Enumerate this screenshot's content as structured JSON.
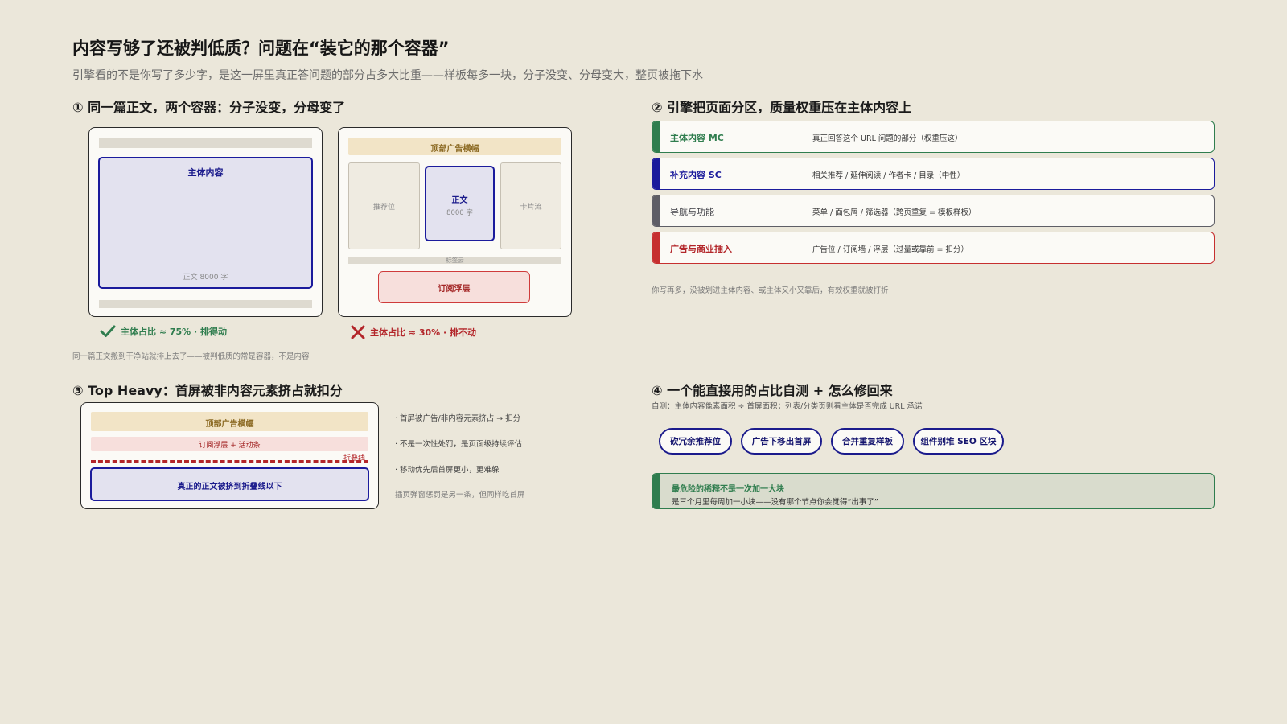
{
  "header": {
    "title": "内容写够了还被判低质？问题在“装它的那个容器”",
    "subtitle": "引擎看的不是你写了多少字，是这一屏里真正答问题的部分占多大比重——样板每多一块，分子没变、分母变大，整页被拖下水"
  },
  "section1": {
    "heading": "① 同一篇正文，两个容器：分子没变，分母变了",
    "clean": {
      "main_label": "主体内容",
      "word_count": "正文 8000 字",
      "verdict_icon": "check-icon",
      "verdict": "主体占比 ≈ 75% · 排得动",
      "verdict_color": "#2f7d4e"
    },
    "cluttered": {
      "ad_banner": "顶部广告横幅",
      "left_col": "推荐位",
      "center_label": "正文",
      "center_count": "8000 字",
      "right_col": "卡片流",
      "tag_cloud": "标签云",
      "sub_layer": "订阅浮层",
      "verdict_icon": "cross-icon",
      "verdict": "主体占比 ≈ 30% · 排不动",
      "verdict_color": "#b3262a"
    },
    "note": "同一篇正文搬到干净站就排上去了——被判低质的常是容器，不是内容"
  },
  "section2": {
    "heading": "② 引擎把页面分区，质量权重压在主体内容上",
    "zones": [
      {
        "name": "主体内容 MC",
        "desc": "真正回答这个 URL 问题的部分（权重压这）",
        "color": "#2f7d4e"
      },
      {
        "name": "补充内容 SC",
        "desc": "相关推荐 / 延伸阅读 / 作者卡 / 目录（中性）",
        "color": "#1b1b9c"
      },
      {
        "name": "导航与功能",
        "desc": "菜单 / 面包屑 / 筛选器（跨页重复 = 模板样板）",
        "color": "#5e5e66"
      },
      {
        "name": "广告与商业插入",
        "desc": "广告位 / 订阅墙 / 浮层（过量或靠前 = 扣分）",
        "color": "#c62f2f"
      }
    ],
    "note": "你写再多，没被划进主体内容、或主体又小又靠后，有效权重就被打折"
  },
  "section3": {
    "heading": "③ Top Heavy：首屏被非内容元素挤占就扣分",
    "ad_banner": "顶部广告横幅",
    "sub_bar": "订阅浮层 + 活动条",
    "fold_label": "折叠线",
    "content_label": "真正的正文被挤到折叠线以下",
    "bullets": [
      "· 首屏被广告/非内容元素挤占 → 扣分",
      "· 不是一次性处罚，是页面级持续评估",
      "· 移动优先后首屏更小，更难躲"
    ],
    "note": "插页弹窗惩罚是另一条，但同样吃首屏"
  },
  "section4": {
    "heading": "④ 一个能直接用的占比自测 + 怎么修回来",
    "selftest": "自测：主体内容像素面积 ÷ 首屏面积；列表/分类页则看主体是否完成 URL 承诺",
    "actions": [
      "砍冗余推荐位",
      "广告下移出首屏",
      "合并重复样板",
      "组件别堆 SEO 区块"
    ],
    "callout": {
      "title": "最危险的稀释不是一次加一大块",
      "body": "是三个月里每周加一小块——没有哪个节点你会觉得“出事了”",
      "color": "#2f7d4e"
    }
  }
}
